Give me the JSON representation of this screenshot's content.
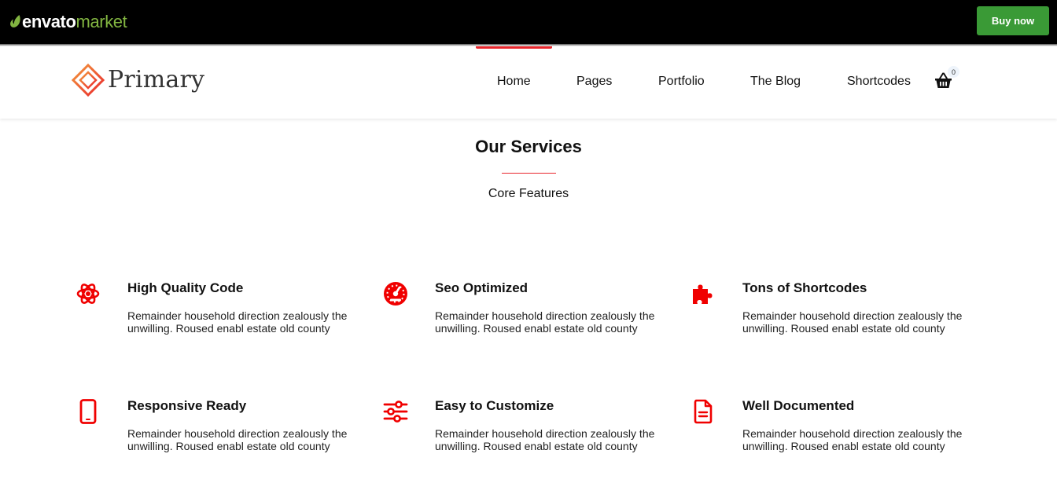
{
  "envato": {
    "brand_part1": "envato",
    "brand_part2": "market",
    "buy_label": "Buy now",
    "colors": {
      "bar": "#000000",
      "leaf": "#82b541",
      "buy": "#3a9a36"
    }
  },
  "header": {
    "brand_name": "Primary",
    "logo_icon": "diamond-logo-icon",
    "nav": [
      "Home",
      "Pages",
      "Portfolio",
      "The Blog",
      "Shortcodes"
    ],
    "active_nav": "Home",
    "cart_icon": "shopping-basket-icon",
    "cart_count": "0",
    "accent_color": "#e9262c"
  },
  "section": {
    "title": "Our Services",
    "subtitle": "Core Features"
  },
  "features": [
    {
      "icon": "atom-icon",
      "title": "High Quality Code",
      "desc": "Remainder household direction zealously the unwilling. Roused enabl estate old county"
    },
    {
      "icon": "speedometer-icon",
      "title": "Seo Optimized",
      "desc": "Remainder household direction zealously the unwilling. Roused enabl estate old county"
    },
    {
      "icon": "puzzle-icon",
      "title": "Tons of Shortcodes",
      "desc": "Remainder household direction zealously the unwilling. Roused enabl estate old county"
    },
    {
      "icon": "mobile-phone-icon",
      "title": "Responsive Ready",
      "desc": "Remainder household direction zealously the unwilling. Roused enabl estate old county"
    },
    {
      "icon": "sliders-icon",
      "title": "Easy to Customize",
      "desc": "Remainder household direction zealously the unwilling. Roused enabl estate old county"
    },
    {
      "icon": "document-icon",
      "title": "Well Documented",
      "desc": "Remainder household direction zealously the unwilling. Roused enabl estate old county"
    }
  ]
}
